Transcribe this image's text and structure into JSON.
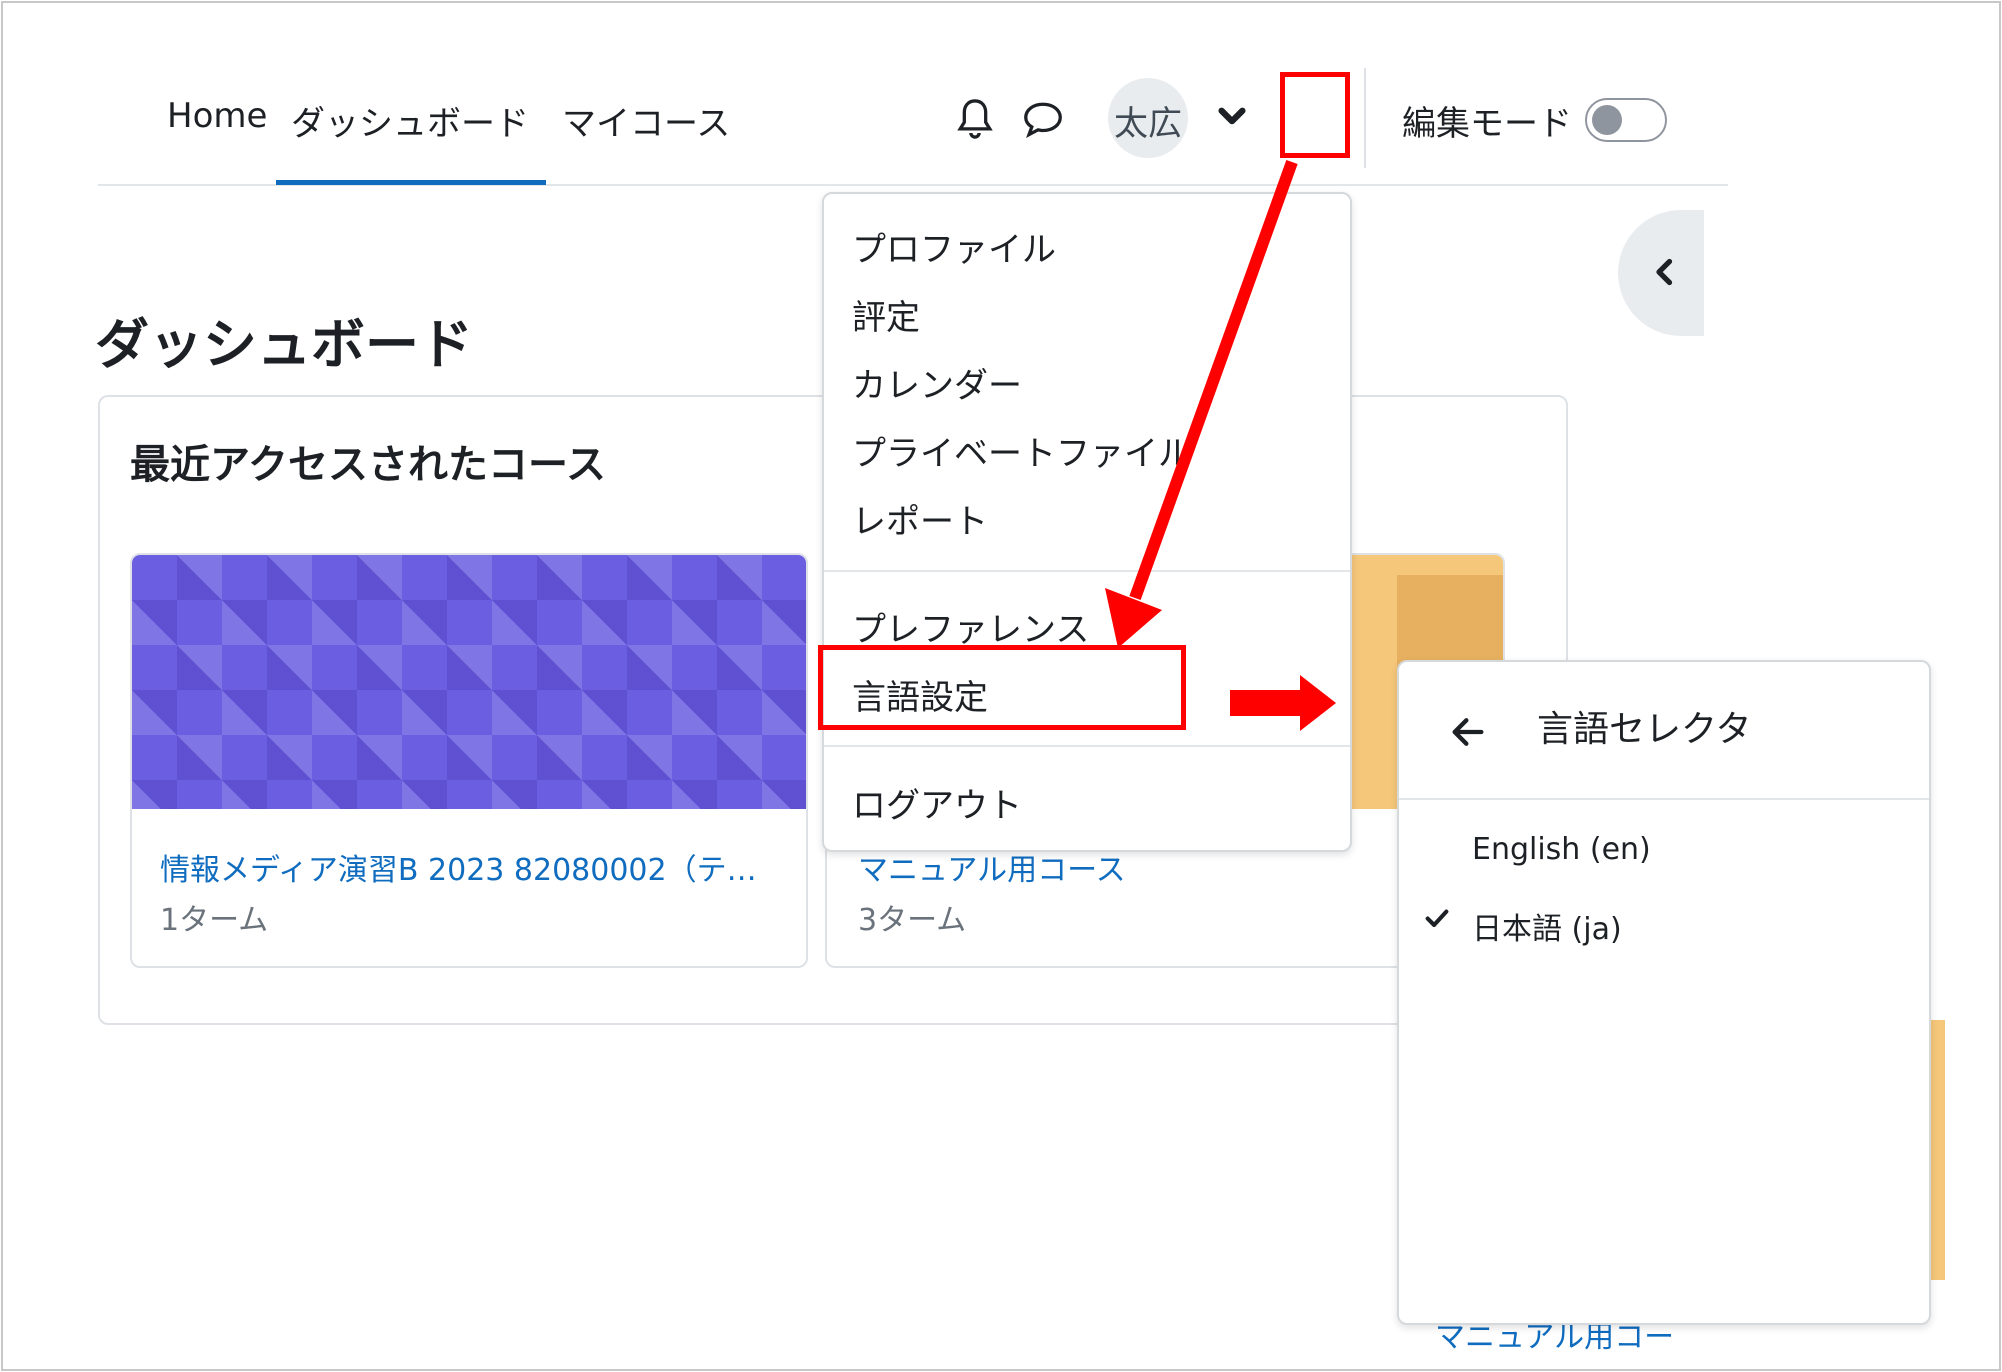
{
  "nav": {
    "links": [
      "Home",
      "ダッシュボード",
      "マイコース"
    ],
    "user_name": "太広",
    "edit_mode_label": "編集モード"
  },
  "page": {
    "title": "ダッシュボード",
    "block_title": "最近アクセスされたコース"
  },
  "courses": [
    {
      "name": "情報メディア演習B 2023 82080002（テ…",
      "term": "1ターム"
    },
    {
      "name": "マニュアル用コース",
      "term": "3ターム"
    }
  ],
  "peek_link": "マニュアル用コー",
  "user_menu": {
    "items": [
      "プロファイル",
      "評定",
      "カレンダー",
      "プライベートファイル",
      "レポート",
      "プレファレンス",
      "言語設定",
      "ログアウト"
    ]
  },
  "language_selector": {
    "title": "言語セレクタ",
    "options": [
      "English (en)",
      "日本語 (ja)"
    ],
    "selected": "日本語 (ja)"
  },
  "colors": {
    "accent": "#0f6cbf",
    "annotation": "#ff0000",
    "card1_image": "#6b5ee0",
    "card2_image": "#f5c77a"
  }
}
